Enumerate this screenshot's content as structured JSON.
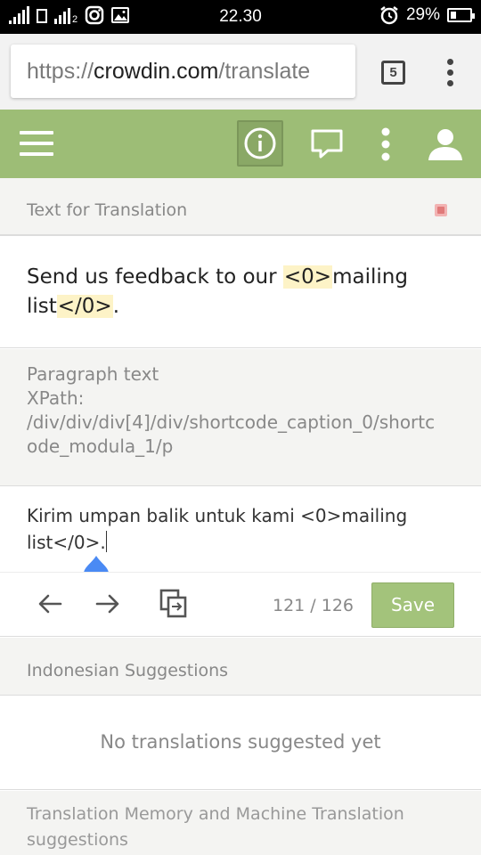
{
  "status_bar": {
    "time": "22.30",
    "battery": "29%",
    "battery_level": 0.29,
    "network_badge": "2"
  },
  "browser": {
    "url_protocol": "https://",
    "url_host": "crowdin.com",
    "url_path": "/translate",
    "tab_count": "5"
  },
  "editor": {
    "section_source_label": "Text for Translation",
    "source_parts": [
      "Send us feedback to our ",
      "<0>",
      "mailing list",
      "</0>",
      "."
    ],
    "context_type": "Paragraph text",
    "context_xpath_label": "XPath:",
    "context_xpath_line1": "/div/div/div[4]/div/shortcode_caption_0/shortc",
    "context_xpath_line2": "ode_modula_1/p",
    "translation_text": "Kirim umpan balik untuk kami <0>mailing list</0>.",
    "counter": "121 / 126",
    "save_label": "Save"
  },
  "suggestions": {
    "section_label": "Indonesian Suggestions",
    "empty_message": "No translations suggested yet",
    "tm_label": "Translation Memory and Machine Translation suggestions"
  },
  "colors": {
    "header_green": "#9dbd76",
    "save_green": "#a3c37b",
    "tag_highlight": "#fdf3c7",
    "handle_blue": "#4a8af4"
  }
}
